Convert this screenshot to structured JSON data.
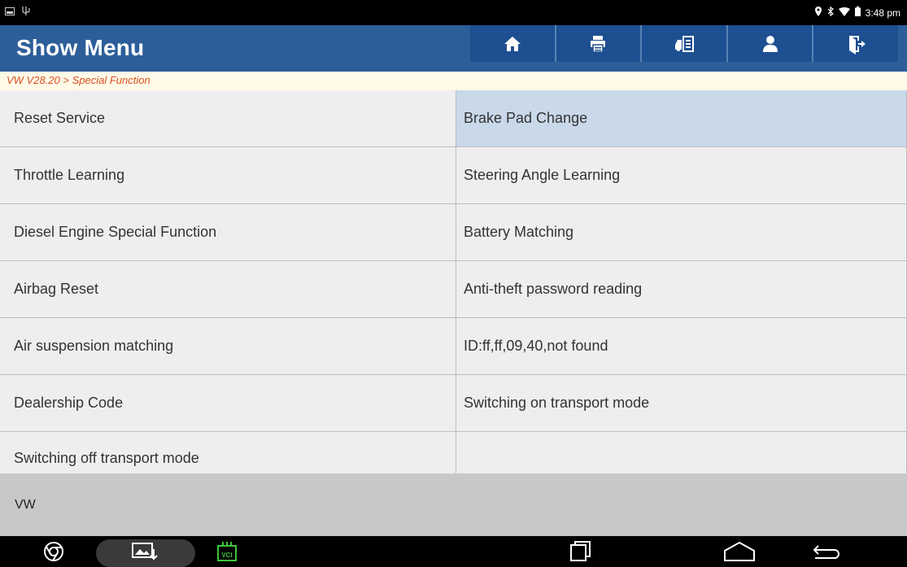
{
  "statusbar": {
    "left_icons": [
      "image-icon",
      "usb-icon"
    ],
    "right_icons": [
      "location-icon",
      "bluetooth-icon",
      "wifi-icon",
      "battery-icon"
    ],
    "time": "3:48 pm"
  },
  "header": {
    "title": "Show Menu",
    "toolbar": [
      {
        "name": "home-button",
        "icon": "home-icon"
      },
      {
        "name": "print-button",
        "icon": "printer-icon"
      },
      {
        "name": "car-report-button",
        "icon": "car-report-icon"
      },
      {
        "name": "user-button",
        "icon": "user-icon"
      },
      {
        "name": "exit-button",
        "icon": "exit-icon"
      }
    ]
  },
  "breadcrumb": "VW V28.20 > Special Function",
  "menu": {
    "items": [
      {
        "label": "Reset Service"
      },
      {
        "label": "Brake Pad Change",
        "selected": true
      },
      {
        "label": "Throttle Learning"
      },
      {
        "label": "Steering Angle Learning"
      },
      {
        "label": "Diesel Engine Special Function"
      },
      {
        "label": "Battery Matching"
      },
      {
        "label": "Airbag Reset"
      },
      {
        "label": "Anti-theft password reading"
      },
      {
        "label": "Air suspension matching"
      },
      {
        "label": "ID:ff,ff,09,40,not found"
      },
      {
        "label": "Dealership Code"
      },
      {
        "label": "Switching on transport mode"
      },
      {
        "label": "Switching off transport mode"
      },
      {
        "label": ""
      }
    ]
  },
  "footer": {
    "brand": "VW"
  },
  "navbar": {
    "vci_label": "VCI",
    "icons": [
      "chrome-icon",
      "screenshot-icon",
      "vci-icon",
      "recent-apps-icon",
      "home-nav-icon",
      "back-icon"
    ]
  },
  "colors": {
    "header_bg": "#2d5e99",
    "toolbar_btn": "#1d4f91",
    "breadcrumb_text": "#d9501e",
    "selected_row": "#c9d9ea"
  }
}
